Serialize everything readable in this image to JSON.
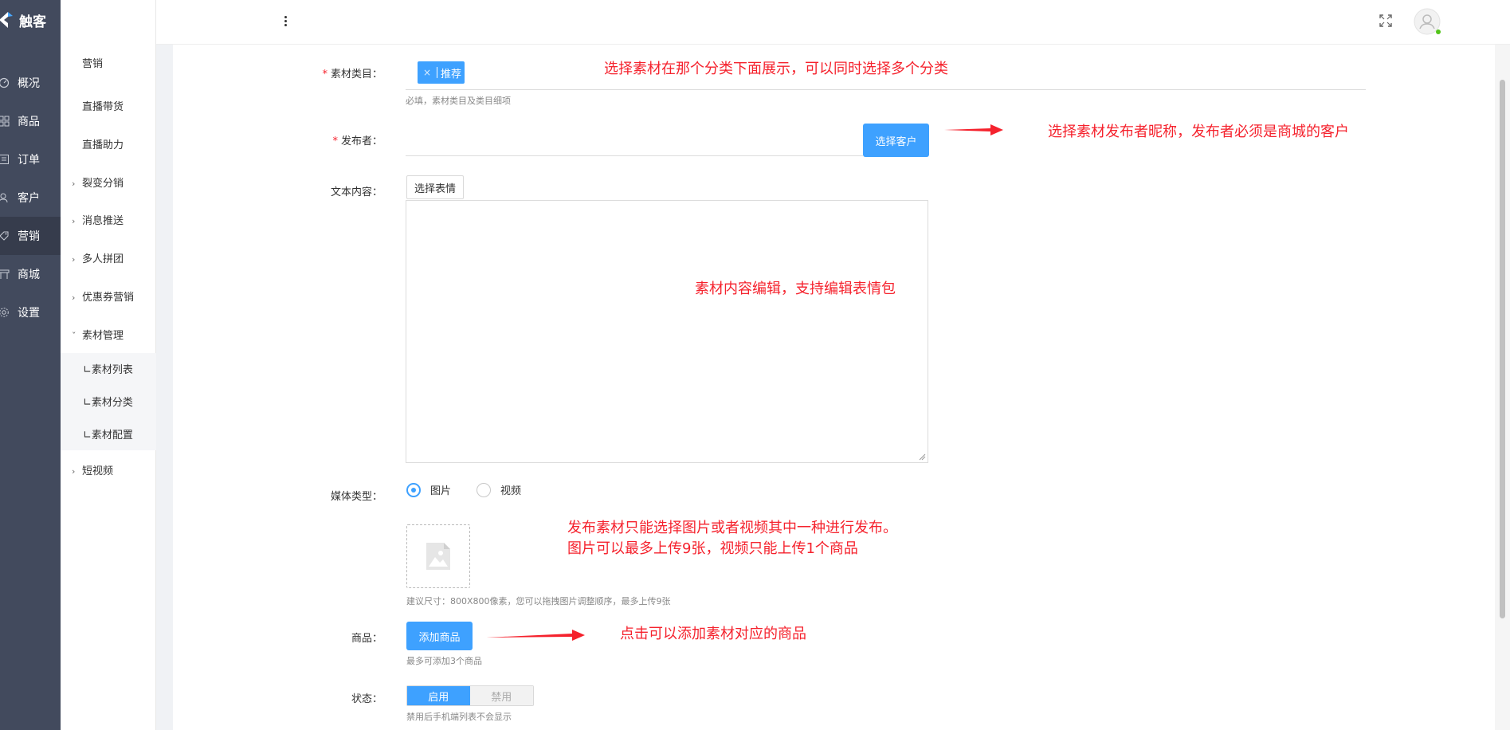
{
  "app": {
    "brand": "触客"
  },
  "nav": {
    "items": [
      {
        "label": "概况",
        "icon": "dashboard-icon"
      },
      {
        "label": "商品",
        "icon": "grid-icon"
      },
      {
        "label": "订单",
        "icon": "order-icon"
      },
      {
        "label": "客户",
        "icon": "users-icon"
      },
      {
        "label": "营销",
        "icon": "marketing-icon"
      },
      {
        "label": "商城",
        "icon": "shop-icon"
      },
      {
        "label": "设置",
        "icon": "gear-icon"
      }
    ],
    "active": "营销"
  },
  "submenu": {
    "title": "营销",
    "items": [
      {
        "label": "直播带货"
      },
      {
        "label": "直播助力"
      },
      {
        "label": "裂变分销"
      },
      {
        "label": "消息推送"
      },
      {
        "label": "多人拼团"
      },
      {
        "label": "优惠券营销"
      },
      {
        "label": "素材管理"
      },
      {
        "label": "短视频"
      }
    ],
    "children": [
      {
        "label": "∟素材列表"
      },
      {
        "label": "∟素材分类"
      },
      {
        "label": "∟素材配置"
      }
    ]
  },
  "form": {
    "category": {
      "label": "素材类目：",
      "tag": "推荐",
      "tag_close": "×",
      "hint": "必填，素材类目及类目细项"
    },
    "publisher": {
      "label": "发布者：",
      "button": "选择客户"
    },
    "text": {
      "label": "文本内容：",
      "emoji_button": "选择表情"
    },
    "media": {
      "label": "媒体类型：",
      "options": [
        "图片",
        "视频"
      ],
      "selected": "图片",
      "hint": "建议尺寸：800X800像素，您可以拖拽图片调整顺序，最多上传9张"
    },
    "product": {
      "label": "商品：",
      "button": "添加商品",
      "hint": "最多可添加3个商品"
    },
    "status": {
      "label": "状态：",
      "on": "启用",
      "off": "禁用",
      "hint": "禁用后手机端列表不会显示"
    }
  },
  "annotations": {
    "category": "选择素材在那个分类下面展示，可以同时选择多个分类",
    "publisher": "选择素材发布者昵称，发布者必须是商城的客户",
    "text": "素材内容编辑，支持编辑表情包",
    "media_line1": "发布素材只能选择图片或者视频其中一种进行发布。",
    "media_line2": "图片可以最多上传9张，视频只能上传1个商品",
    "product": "点击可以添加素材对应的商品"
  },
  "colors": {
    "primary": "#3ea1ff",
    "nav_bg": "#424a5d",
    "annotation": "#f5222d"
  }
}
